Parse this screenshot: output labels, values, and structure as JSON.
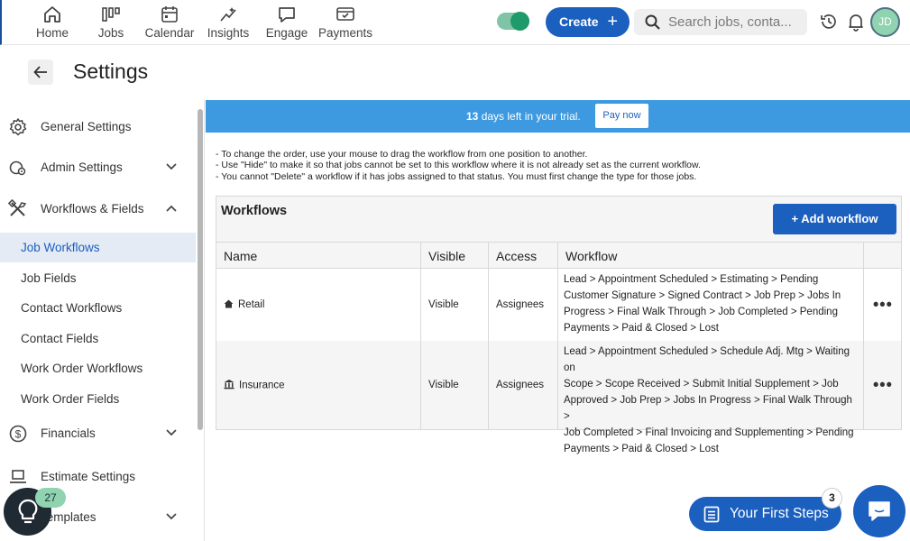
{
  "nav": {
    "items": [
      {
        "label": "Home",
        "icon": "home-icon"
      },
      {
        "label": "Jobs",
        "icon": "jobs-icon"
      },
      {
        "label": "Calendar",
        "icon": "calendar-icon"
      },
      {
        "label": "Insights",
        "icon": "insights-icon"
      },
      {
        "label": "Engage",
        "icon": "engage-icon"
      },
      {
        "label": "Payments",
        "icon": "payments-icon"
      }
    ],
    "toggle_on": true,
    "create_label": "Create",
    "search_placeholder": "Search jobs, conta...",
    "avatar_initials": "JD"
  },
  "header": {
    "title": "Settings"
  },
  "sidebar": {
    "items": [
      {
        "label": "General Settings",
        "icon": "gear-icon"
      },
      {
        "label": "Admin Settings",
        "icon": "admin-icon"
      },
      {
        "label": "Workflows & Fields",
        "icon": "tools-icon"
      }
    ],
    "subitems": [
      {
        "label": "Job Workflows"
      },
      {
        "label": "Job Fields"
      },
      {
        "label": "Contact Workflows"
      },
      {
        "label": "Contact Fields"
      },
      {
        "label": "Work Order Workflows"
      },
      {
        "label": "Work Order Fields"
      }
    ],
    "items_after": [
      {
        "label": "Financials",
        "icon": "dollar-icon"
      },
      {
        "label": "Estimate Settings",
        "icon": "estimate-icon"
      },
      {
        "label": "Templates",
        "icon": "templates-icon"
      }
    ]
  },
  "banner": {
    "days": "13",
    "text": " days left in your trial.",
    "pay_label": "Pay now"
  },
  "instructions": [
    "- To change the order, use your mouse to drag the workflow from one position to another.",
    "- Use \"Hide\" to make it so that jobs cannot be set to this workflow where it is not already set as the current workflow.",
    "- You cannot \"Delete\" a workflow if it has jobs assigned to that status. You must first change the type for those jobs."
  ],
  "workflows": {
    "title": "Workflows",
    "add_label": "+ Add workflow",
    "columns": [
      "Name",
      "Visible",
      "Access",
      "Workflow"
    ],
    "rows": [
      {
        "name": "Retail",
        "icon": "house-icon",
        "visible": "Visible",
        "access": "Assignees",
        "workflow_lines": [
          "Lead > Appointment Scheduled > Estimating > Pending",
          "Customer Signature > Signed Contract > Job Prep > Jobs In",
          "Progress > Final Walk Through > Job Completed > Pending",
          "Payments > Paid & Closed > Lost"
        ]
      },
      {
        "name": "Insurance",
        "icon": "bank-icon",
        "visible": "Visible",
        "access": "Assignees",
        "workflow_lines": [
          "Lead > Appointment Scheduled > Schedule Adj. Mtg > Waiting on",
          "Scope > Scope Received > Submit Initial Supplement > Job",
          "Approved > Job Prep > Jobs In Progress > Final Walk Through >",
          "Job Completed > Final Invoicing and Supplementing > Pending",
          "Payments > Paid & Closed > Lost"
        ]
      }
    ],
    "more_label": "•••"
  },
  "overlays": {
    "tips_count": "27",
    "first_steps_label": "Your First Steps",
    "first_steps_count": "3"
  }
}
